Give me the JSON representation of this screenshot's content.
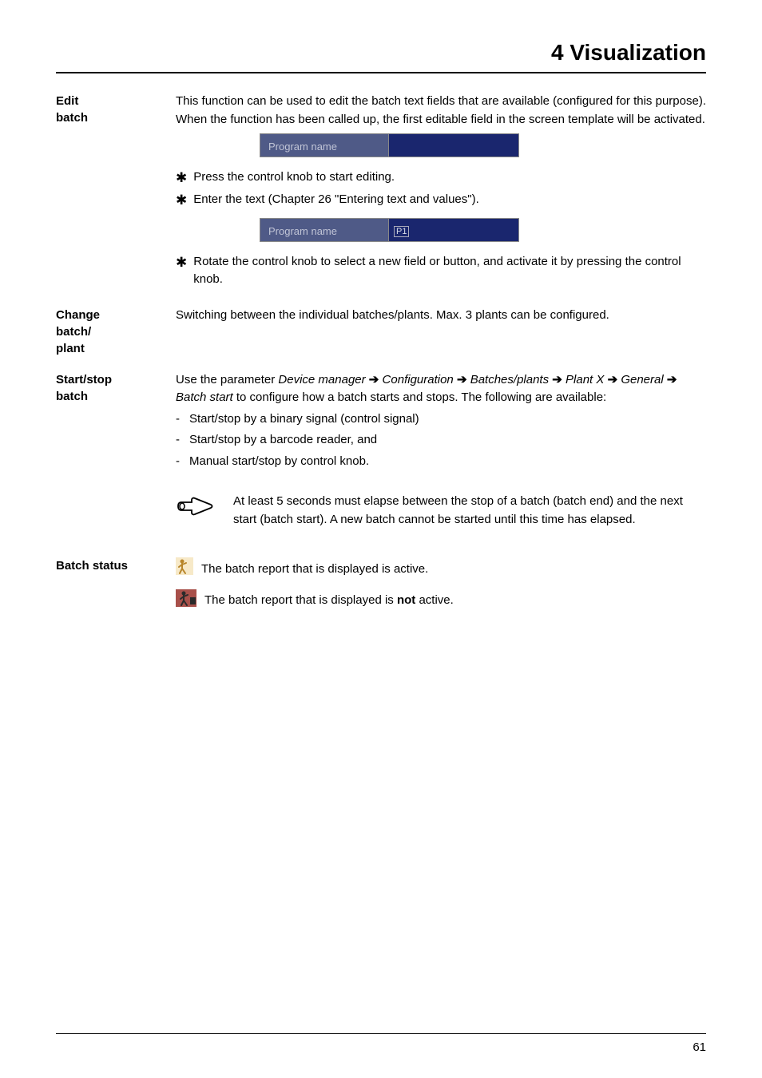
{
  "header": {
    "title": "4 Visualization"
  },
  "sections": {
    "editBatch": {
      "label": "Edit\nbatch",
      "intro": "This function can be used to edit the batch text fields that are available (configured for this purpose). When the function has been called up, the first editable field in the screen template will be activated.",
      "preview1Label": "Program name",
      "action1": "Press the control knob to start editing.",
      "action2": "Enter the text (Chapter 26 \"Entering text and values\").",
      "preview2Label": "Program name",
      "preview2Value": "P1",
      "action3": "Rotate the control knob to select a new field or button, and activate it by pressing the control knob."
    },
    "changeBatch": {
      "label": "Change\nbatch/\nplant",
      "text": "Switching between the individual batches/plants. Max. 3 plants can be configured."
    },
    "startStop": {
      "label": "Start/stop\nbatch",
      "introPre": "Use the parameter ",
      "paramPath1": "Device manager",
      "paramPath2": "Configuration",
      "paramPath3": "Batches/plants",
      "paramPath4": "Plant X",
      "paramPath5": "General",
      "paramPath6": "Batch start",
      "introPost": " to configure how a batch starts and stops. The following are available:",
      "item1": "Start/stop by a binary signal (control signal)",
      "item2": "Start/stop by a barcode reader, and",
      "item3": "Manual start/stop by control knob.",
      "note": "At least 5 seconds must elapse between the stop of a batch (batch end) and the next start (batch start). A new batch cannot be started until this time has elapsed."
    },
    "batchStatus": {
      "label": "Batch status",
      "active": "The batch report that is displayed is active.",
      "notActivePre": "The batch report that is displayed is ",
      "notActiveBold": "not",
      "notActivePost": " active."
    }
  },
  "pageNumber": "61"
}
